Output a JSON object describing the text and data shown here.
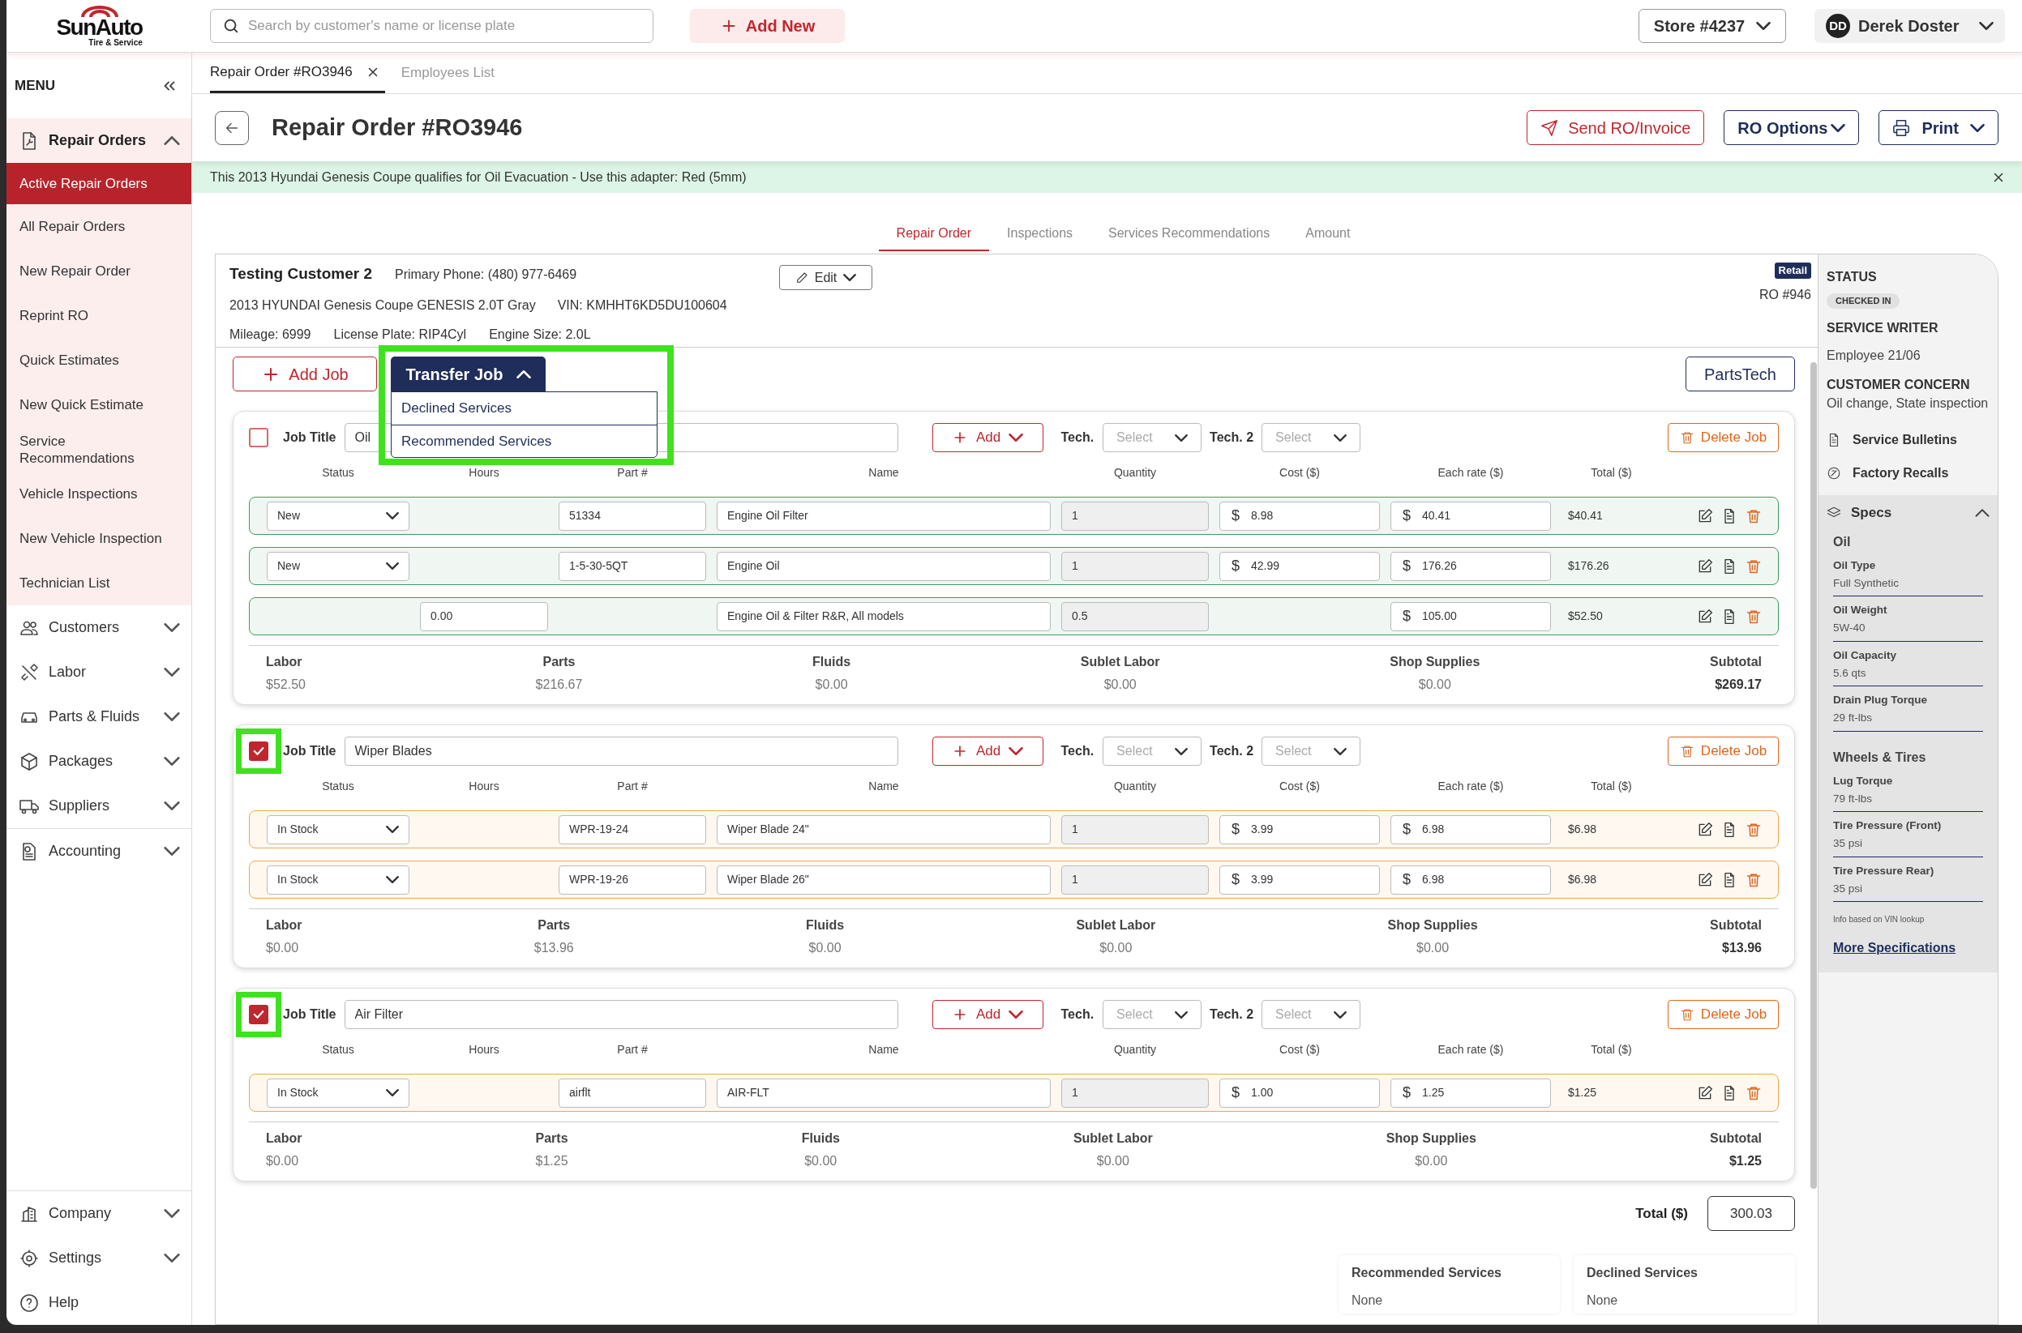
{
  "logo": {
    "name": "SunAuto",
    "tagline": "Tire & Service"
  },
  "search": {
    "placeholder": "Search by customer's name or license plate"
  },
  "add_new": "Add New",
  "store": "Store #4237",
  "user": {
    "initials": "DD",
    "name": "Derek Doster"
  },
  "sidebar": {
    "title": "MENU",
    "groups": [
      {
        "label": "Repair Orders",
        "expanded": true,
        "children": [
          {
            "label": "Active Repair Orders",
            "selected": true
          },
          {
            "label": "All Repair Orders",
            "selected": false
          },
          {
            "label": "New Repair Order",
            "selected": false
          },
          {
            "label": "Reprint RO",
            "selected": false
          },
          {
            "label": "Quick Estimates",
            "selected": false
          },
          {
            "label": "New Quick Estimate",
            "selected": false
          },
          {
            "label": "Service Recommendations",
            "selected": false
          },
          {
            "label": "Vehicle Inspections",
            "selected": false
          },
          {
            "label": "New Vehicle Inspection",
            "selected": false
          },
          {
            "label": "Technician List",
            "selected": false
          }
        ]
      },
      {
        "label": "Customers",
        "expanded": false
      },
      {
        "label": "Labor",
        "expanded": false
      },
      {
        "label": "Parts & Fluids",
        "expanded": false
      },
      {
        "label": "Packages",
        "expanded": false
      },
      {
        "label": "Suppliers",
        "expanded": false
      },
      {
        "label": "Accounting",
        "expanded": false
      }
    ],
    "footer": [
      {
        "label": "Company",
        "expanded": false
      },
      {
        "label": "Settings",
        "expanded": false
      },
      {
        "label": "Help"
      }
    ]
  },
  "tabs": [
    {
      "label": "Repair Order #RO3946",
      "selected": true,
      "closable": true
    },
    {
      "label": "Employees List",
      "selected": false,
      "closable": false
    }
  ],
  "title": "Repair Order #RO3946",
  "actions": [
    {
      "kind": "send",
      "label": "Send RO/Invoice"
    },
    {
      "kind": "menu",
      "label": "RO Options"
    },
    {
      "kind": "print",
      "label": "Print"
    }
  ],
  "banner": {
    "text": "This 2013 Hyundai Genesis Coupe qualifies for Oil Evacuation - Use this adapter: Red (5mm)"
  },
  "ro_tabs": [
    {
      "label": "Repair Order",
      "selected": true
    },
    {
      "label": "Inspections",
      "selected": false
    },
    {
      "label": "Services Recommendations",
      "selected": false
    },
    {
      "label": "Amount",
      "selected": false
    }
  ],
  "customer": {
    "name": "Testing Customer 2",
    "phone": "Primary Phone: (480) 977-6469",
    "vehicle": "2013 HYUNDAI Genesis Coupe GENESIS 2.0T Gray",
    "vin": "VIN: KMHHT6KD5DU100604",
    "details": [
      "Mileage: 6999",
      "License Plate: RIP4Cyl",
      "Engine Size: 2.0L"
    ]
  },
  "edit": "Edit",
  "ro_type": "Retail",
  "ro_number": "RO #946",
  "add_job": "Add Job",
  "transfer": {
    "label": "Transfer Job",
    "expanded": true,
    "highlighted": true,
    "options": [
      "Declined Services",
      "Recommended Services"
    ]
  },
  "partstech": "PartsTech",
  "jobs": [
    {
      "checked": false,
      "highlighted": false,
      "title_label": "Job Title",
      "title": "Oil",
      "add": "Add",
      "tech_label": "Tech.",
      "tech": "Select",
      "tech2_label": "Tech. 2",
      "tech2": "Select",
      "delete": "Delete Job",
      "columns": [
        "Status",
        "Hours",
        "Part #",
        "Name",
        "Quantity",
        "Cost ($)",
        "Each rate ($)",
        "Total ($)"
      ],
      "rows": [
        {
          "kind": "part",
          "color": "#3f9a5e",
          "status": "New",
          "part": "51334",
          "name": "Engine Oil Filter",
          "quantity": "1",
          "cost": {
            "symbol": "$",
            "value": "8.98"
          },
          "rate": {
            "symbol": "$",
            "value": "40.41"
          },
          "total": "$40.41"
        },
        {
          "kind": "part",
          "color": "#3f9a5e",
          "status": "New",
          "part": "1-5-30-5QT",
          "name": "Engine Oil",
          "quantity": "1",
          "cost": {
            "symbol": "$",
            "value": "42.99"
          },
          "rate": {
            "symbol": "$",
            "value": "176.26"
          },
          "total": "$176.26"
        },
        {
          "kind": "labor",
          "color": "#3f9a5e",
          "hours": "0.00",
          "name": "Engine Oil & Filter R&R, All models",
          "quantity": "0.5",
          "rate": {
            "symbol": "$",
            "value": "105.00"
          },
          "total": "$52.50"
        }
      ],
      "summary": [
        {
          "label": "Labor",
          "value": "$52.50"
        },
        {
          "label": "Parts",
          "value": "$216.67"
        },
        {
          "label": "Fluids",
          "value": "$0.00"
        },
        {
          "label": "Sublet Labor",
          "value": "$0.00"
        },
        {
          "label": "Shop Supplies",
          "value": "$0.00"
        },
        {
          "label": "Subtotal",
          "value": "$269.17"
        }
      ]
    },
    {
      "checked": true,
      "highlighted": true,
      "title_label": "Job Title",
      "title": "Wiper Blades",
      "add": "Add",
      "tech_label": "Tech.",
      "tech": "Select",
      "tech2_label": "Tech. 2",
      "tech2": "Select",
      "delete": "Delete Job",
      "columns": [
        "Status",
        "Hours",
        "Part #",
        "Name",
        "Quantity",
        "Cost ($)",
        "Each rate ($)",
        "Total ($)"
      ],
      "rows": [
        {
          "kind": "part",
          "color": "#eda949",
          "status": "In Stock",
          "part": "WPR-19-24",
          "name": "Wiper Blade 24\"",
          "quantity": "1",
          "cost": {
            "symbol": "$",
            "value": "3.99"
          },
          "rate": {
            "symbol": "$",
            "value": "6.98"
          },
          "total": "$6.98"
        },
        {
          "kind": "part",
          "color": "#eda949",
          "status": "In Stock",
          "part": "WPR-19-26",
          "name": "Wiper Blade 26\"",
          "quantity": "1",
          "cost": {
            "symbol": "$",
            "value": "3.99"
          },
          "rate": {
            "symbol": "$",
            "value": "6.98"
          },
          "total": "$6.98"
        }
      ],
      "summary": [
        {
          "label": "Labor",
          "value": "$0.00"
        },
        {
          "label": "Parts",
          "value": "$13.96"
        },
        {
          "label": "Fluids",
          "value": "$0.00"
        },
        {
          "label": "Sublet Labor",
          "value": "$0.00"
        },
        {
          "label": "Shop Supplies",
          "value": "$0.00"
        },
        {
          "label": "Subtotal",
          "value": "$13.96"
        }
      ]
    },
    {
      "checked": true,
      "highlighted": true,
      "title_label": "Job Title",
      "title": "Air Filter",
      "add": "Add",
      "tech_label": "Tech.",
      "tech": "Select",
      "tech2_label": "Tech. 2",
      "tech2": "Select",
      "delete": "Delete Job",
      "columns": [
        "Status",
        "Hours",
        "Part #",
        "Name",
        "Quantity",
        "Cost ($)",
        "Each rate ($)",
        "Total ($)"
      ],
      "rows": [
        {
          "kind": "part",
          "color": "#eda949",
          "status": "In Stock",
          "part": "airflt",
          "name": "AIR-FLT",
          "quantity": "1",
          "cost": {
            "symbol": "$",
            "value": "1.00"
          },
          "rate": {
            "symbol": "$",
            "value": "1.25"
          },
          "total": "$1.25"
        }
      ],
      "summary": [
        {
          "label": "Labor",
          "value": "$0.00"
        },
        {
          "label": "Parts",
          "value": "$1.25"
        },
        {
          "label": "Fluids",
          "value": "$0.00"
        },
        {
          "label": "Sublet Labor",
          "value": "$0.00"
        },
        {
          "label": "Shop Supplies",
          "value": "$0.00"
        },
        {
          "label": "Subtotal",
          "value": "$1.25"
        }
      ]
    }
  ],
  "total": {
    "label": "Total ($)",
    "value": "300.03"
  },
  "lists": [
    {
      "title": "Recommended Services",
      "value": "None"
    },
    {
      "title": "Declined Services",
      "value": "None"
    }
  ],
  "status_panel": {
    "status_label": "STATUS",
    "status": "CHECKED IN",
    "writer_label": "SERVICE WRITER",
    "writer": "Employee 21/06",
    "concern_label": "CUSTOMER CONCERN",
    "concern": "Oil change, State inspection",
    "links": [
      "Service Bulletins",
      "Factory Recalls"
    ],
    "specs": {
      "title": "Specs",
      "expanded": true,
      "sections": [
        {
          "title": "Oil",
          "items": [
            {
              "label": "Oil Type",
              "value": "Full Synthetic"
            },
            {
              "label": "Oil Weight",
              "value": "5W-40"
            },
            {
              "label": "Oil Capacity",
              "value": "5.6 qts"
            },
            {
              "label": "Drain Plug Torque",
              "value": "29 ft-lbs"
            }
          ]
        },
        {
          "title": "Wheels & Tires",
          "items": [
            {
              "label": "Lug Torque",
              "value": "79 ft-lbs"
            },
            {
              "label": "Tire Pressure (Front)",
              "value": "35 psi"
            },
            {
              "label": "Tire Pressure Rear)",
              "value": "35 psi"
            }
          ]
        }
      ],
      "note": "Info based on VIN lookup",
      "more": "More Specifications"
    }
  }
}
